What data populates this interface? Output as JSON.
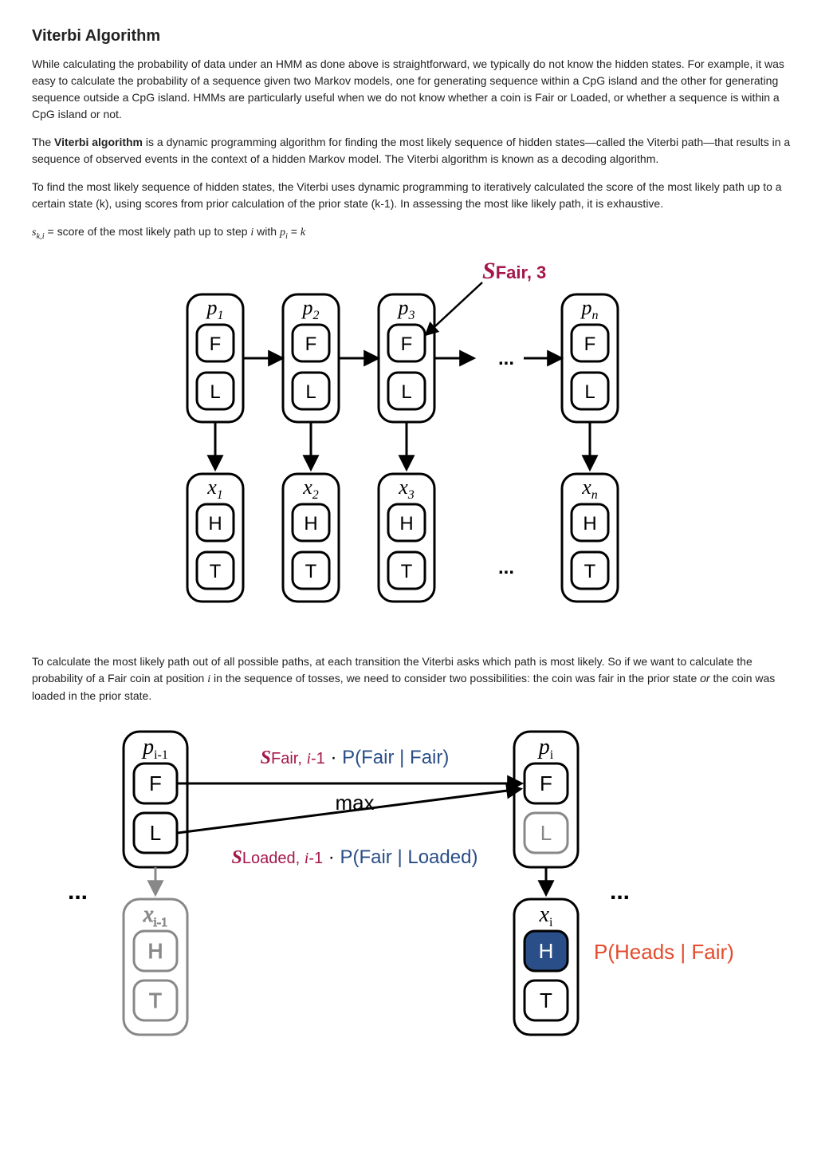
{
  "title": "Viterbi Algorithm",
  "para1": "While calculating the probability of data under an HMM as done above is straightforward, we typically do not know the hidden states. For example, it was easy to calculate the probability of a sequence given two Markov models, one for generating sequence within a CpG island and the other for generating sequence outside a CpG island. HMMs are particularly useful when we do not know whether a coin is Fair or Loaded, or whether a sequence is within a CpG island or not.",
  "para2_a": "The ",
  "para2_bold": "Viterbi algorithm",
  "para2_b": " is a dynamic programming algorithm for finding the most likely sequence of hidden states—called the Viterbi path—that results in a sequence of observed events in the context of a hidden Markov model. The Viterbi algorithm is known as a decoding algorithm.",
  "para3": "To find the most likely sequence of hidden states, the Viterbi uses dynamic programming to iteratively calculated the score of the most likely path up to a certain state (k), using scores from prior calculation of the prior state (k-1). In assessing the most like likely path, it is exhaustive.",
  "score_phrase": " = score of the most likely path up to step ",
  "score_with": " with ",
  "para4_a": "To calculate the most likely path out of all possible paths, at each transition the Viterbi asks which path is most likely. So if we want to calculate the probability of a Fair coin at position ",
  "para4_b": " in the sequence of tosses, we need to consider two possibilities: the coin was fair in the prior state ",
  "para4_or": "or",
  "para4_c": " the coin was loaded in the prior state.",
  "fig1": {
    "annot": "SFair, 3",
    "nodes": [
      {
        "p": "p",
        "psub": "1",
        "x": "x",
        "xsub": "1"
      },
      {
        "p": "p",
        "psub": "2",
        "x": "x",
        "xsub": "2"
      },
      {
        "p": "p",
        "psub": "3",
        "x": "x",
        "xsub": "3"
      },
      {
        "p": "p",
        "psub": "n",
        "x": "x",
        "xsub": "n"
      }
    ],
    "F": "F",
    "L": "L",
    "H": "H",
    "T": "T",
    "dots": "..."
  },
  "fig2": {
    "left_p": "p",
    "left_psub": "i-1",
    "left_x": "x",
    "left_xsub": "i-1",
    "right_p": "p",
    "right_psub": "i",
    "right_x": "x",
    "right_xsub": "i",
    "F": "F",
    "L": "L",
    "H": "H",
    "T": "T",
    "max": "max",
    "top_s": "S",
    "top_s_sub": "Fair, i-1",
    "top_dot": " · ",
    "top_p": "P(Fair | Fair)",
    "bot_s": "S",
    "bot_s_sub": "Loaded, i-1",
    "bot_dot": " · ",
    "bot_p": "P(Fair | Loaded)",
    "emission": "P(Heads | Fair)",
    "dots": "..."
  }
}
